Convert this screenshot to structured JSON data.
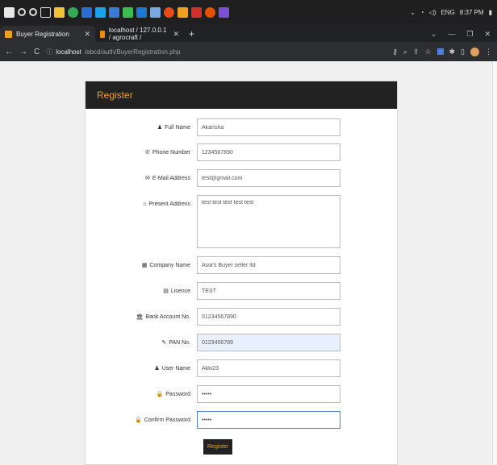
{
  "taskbar": {
    "icons": [
      "windows-icon",
      "search-icon",
      "cortana-icon",
      "task-view-icon",
      "app-icon",
      "chrome-icon",
      "app-icon",
      "app-icon",
      "app-icon",
      "app-icon",
      "app-icon",
      "app-icon",
      "app-icon",
      "app-icon",
      "app-icon",
      "app-icon",
      "vscode-icon"
    ],
    "language": "ENG",
    "time": "8:37 PM"
  },
  "tabs": [
    {
      "label": "Buyer Registration",
      "active": true
    },
    {
      "label": "localhost / 127.0.0.1 / agrocraft /",
      "active": false
    }
  ],
  "address": {
    "host": "localhost",
    "path": "/abcd/auth/BuyerRegistration.php"
  },
  "form": {
    "title": "Register",
    "fields": {
      "full_name": {
        "label": "Full Name",
        "value": "Akansha"
      },
      "phone": {
        "label": "Phone Number",
        "value": "1234567890"
      },
      "email": {
        "label": "E-Mail Address",
        "value": "test@gmail.com"
      },
      "address": {
        "label": "Present Address",
        "value": "test test test test test"
      },
      "company": {
        "label": "Company Name",
        "value": "Asia's Buyer seller ltd"
      },
      "licence": {
        "label": "Lisence",
        "value": "TEST"
      },
      "bank": {
        "label": "Bank Account No.",
        "value": "01234567890"
      },
      "pan": {
        "label": "PAN No.",
        "value": "0123456789"
      },
      "username": {
        "label": "User Name",
        "value": "Akki23"
      },
      "password": {
        "label": "Password",
        "value": "•••••"
      },
      "confirm": {
        "label": "Confirm Password",
        "value": "•••••"
      }
    },
    "submit_label": "Register"
  }
}
